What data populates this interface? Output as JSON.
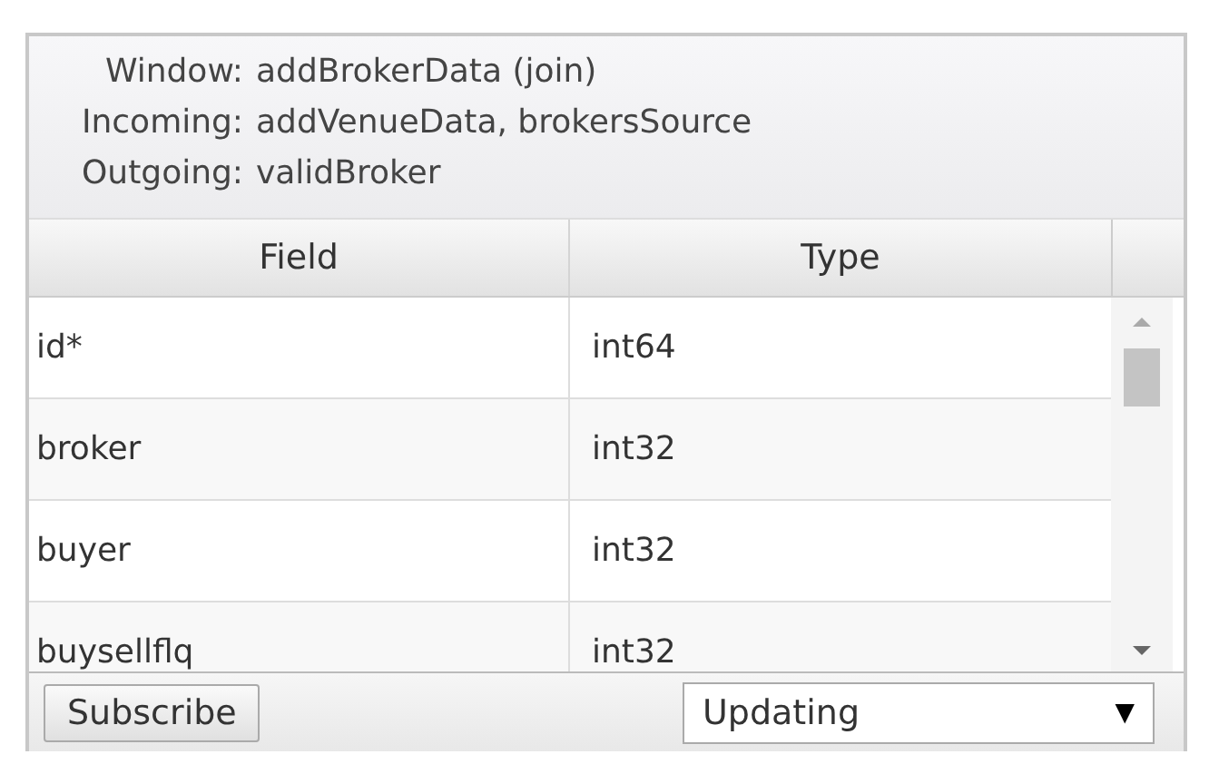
{
  "info": [
    {
      "label": "Window:",
      "value": "addBrokerData (join)"
    },
    {
      "label": "Incoming:",
      "value": "addVenueData, brokersSource"
    },
    {
      "label": "Outgoing:",
      "value": "validBroker"
    }
  ],
  "table": {
    "columns": [
      "Field",
      "Type"
    ],
    "rows": [
      {
        "field": "id*",
        "type": "int64"
      },
      {
        "field": "broker",
        "type": "int32"
      },
      {
        "field": "buyer",
        "type": "int32"
      },
      {
        "field": "buysellflq",
        "type": "int32"
      }
    ]
  },
  "subscribe_button": "Subscribe",
  "mode_select": {
    "value": "Updating",
    "arrow": "▼"
  }
}
